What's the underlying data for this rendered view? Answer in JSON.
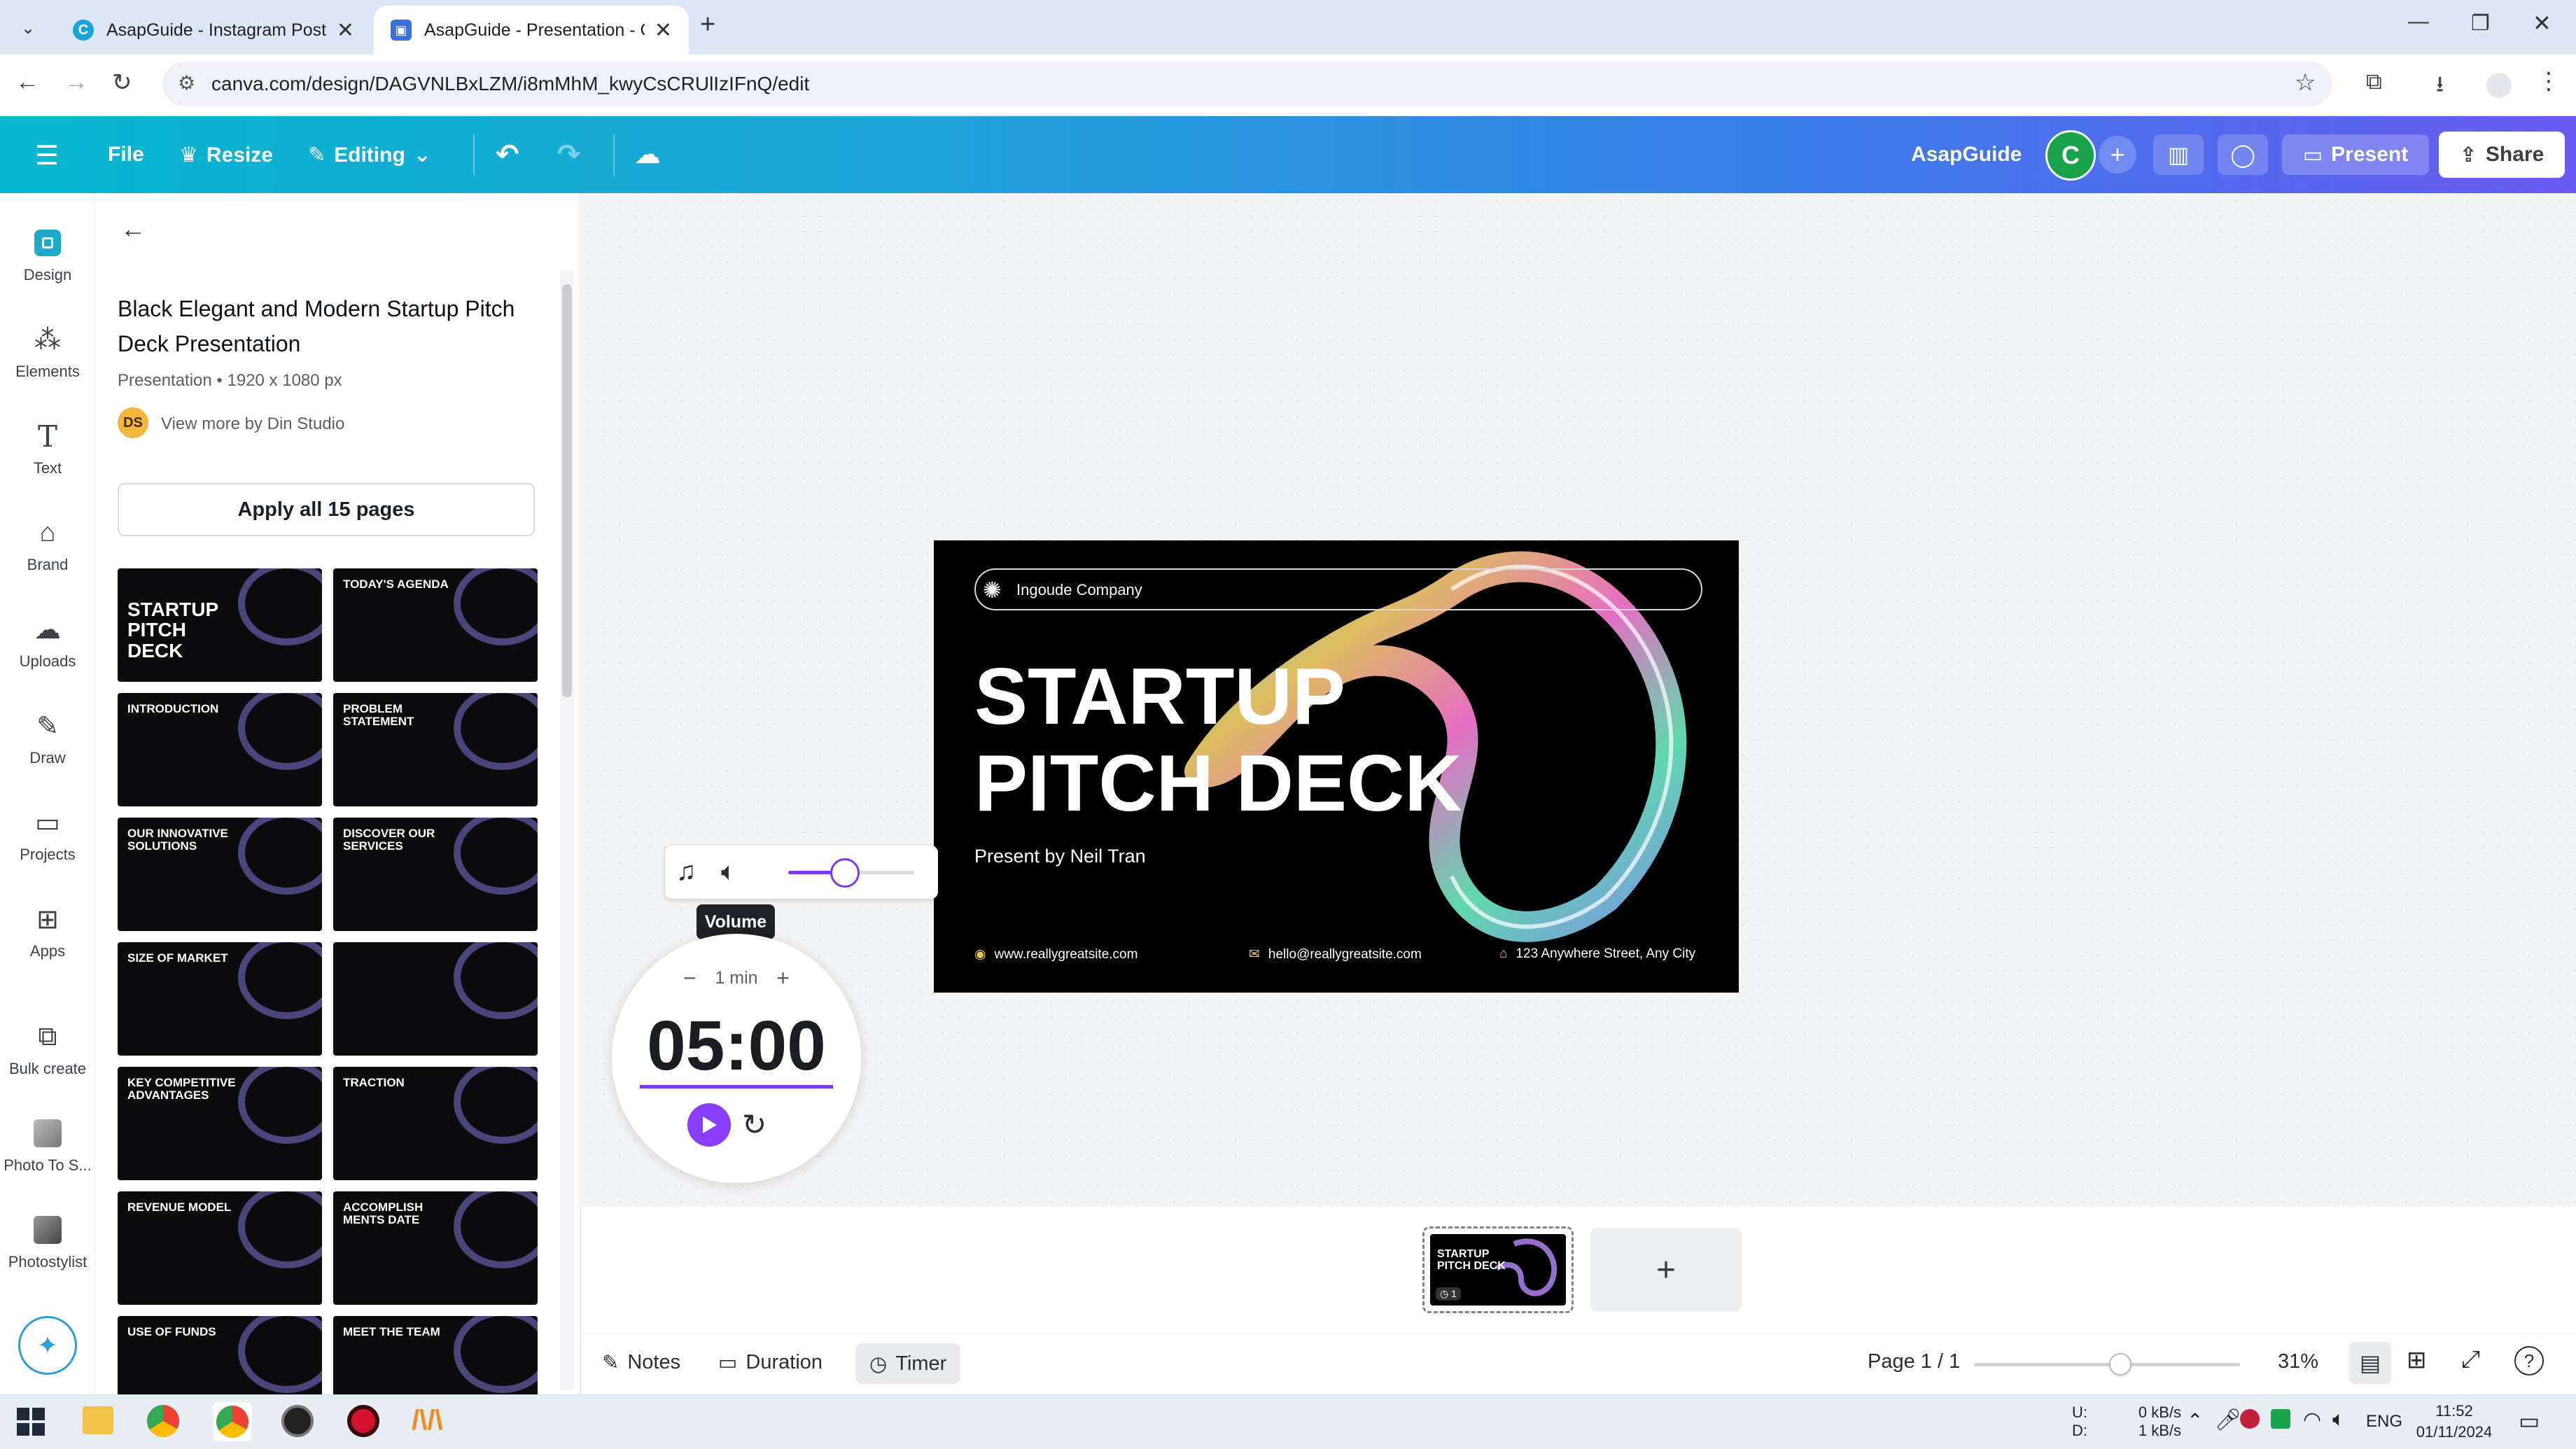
{
  "browser": {
    "tabs": [
      {
        "title": "AsapGuide - Instagram Post - C",
        "active": false
      },
      {
        "title": "AsapGuide - Presentation - Car",
        "active": true
      }
    ],
    "url": "canva.com/design/DAGVNLBxLZM/i8mMhM_kwyCsCRUlIzIFnQ/edit"
  },
  "header": {
    "file": "File",
    "resize": "Resize",
    "editing": "Editing",
    "team_name": "AsapGuide",
    "avatar_letter": "C",
    "present": "Present",
    "share": "Share"
  },
  "rail": {
    "items": [
      {
        "label": "Design",
        "icon": "design-icon"
      },
      {
        "label": "Elements",
        "icon": "elements-icon"
      },
      {
        "label": "Text",
        "icon": "text-icon"
      },
      {
        "label": "Brand",
        "icon": "brand-icon"
      },
      {
        "label": "Uploads",
        "icon": "uploads-icon"
      },
      {
        "label": "Draw",
        "icon": "draw-icon"
      },
      {
        "label": "Projects",
        "icon": "projects-icon"
      },
      {
        "label": "Apps",
        "icon": "apps-icon"
      },
      {
        "label": "Bulk create",
        "icon": "bulk-create-icon"
      },
      {
        "label": "Photo To S...",
        "icon": "photo-to-sketch-icon"
      },
      {
        "label": "Photostylist",
        "icon": "photostylist-icon"
      }
    ]
  },
  "panel": {
    "title": "Black Elegant and Modern Startup Pitch Deck Presentation",
    "meta": "Presentation • 1920 x 1080 px",
    "author_initials": "DS",
    "author_link": "View more by Din Studio",
    "apply_button": "Apply all 15 pages",
    "thumbnails": [
      "STARTUP PITCH DECK",
      "TODAY'S AGENDA",
      "INTRODUCTION",
      "PROBLEM STATEMENT",
      "OUR INNOVATIVE SOLUTIONS",
      "DISCOVER OUR SERVICES",
      "SIZE OF MARKET",
      "",
      "KEY COMPETITIVE ADVANTAGES",
      "TRACTION",
      "REVENUE MODEL",
      "ACCOMPLISH MENTS DATE",
      "USE OF FUNDS",
      "MEET THE TEAM"
    ]
  },
  "slide": {
    "company": "Ingoude Company",
    "title_line1": "STARTUP",
    "title_line2": "PITCH DECK",
    "presenter": "Present by Neil Tran",
    "website": "www.reallygreatsite.com",
    "email": "hello@reallygreatsite.com",
    "address": "123 Anywhere Street, Any City"
  },
  "timer": {
    "volume_tooltip": "Volume",
    "volume_level": 0.45,
    "step": "1 min",
    "time": "05:00"
  },
  "pages": {
    "thumb_title": "STARTUP PITCH DECK",
    "thumb_number": "1"
  },
  "footer": {
    "notes": "Notes",
    "duration": "Duration",
    "timer": "Timer",
    "page_indicator": "Page 1 / 1",
    "zoom_level": 0.55,
    "zoom": "31%"
  },
  "taskbar": {
    "net_up_label": "U:",
    "net_down_label": "D:",
    "net_up": "0 kB/s",
    "net_down": "1 kB/s",
    "lang": "ENG",
    "time": "11:52",
    "date": "01/11/2024"
  },
  "colors": {
    "accent_purple": "#8b3dff",
    "header_gradient_start": "#07b7cf",
    "header_gradient_end": "#6b5bf2",
    "avatar_green": "#18a34a"
  }
}
